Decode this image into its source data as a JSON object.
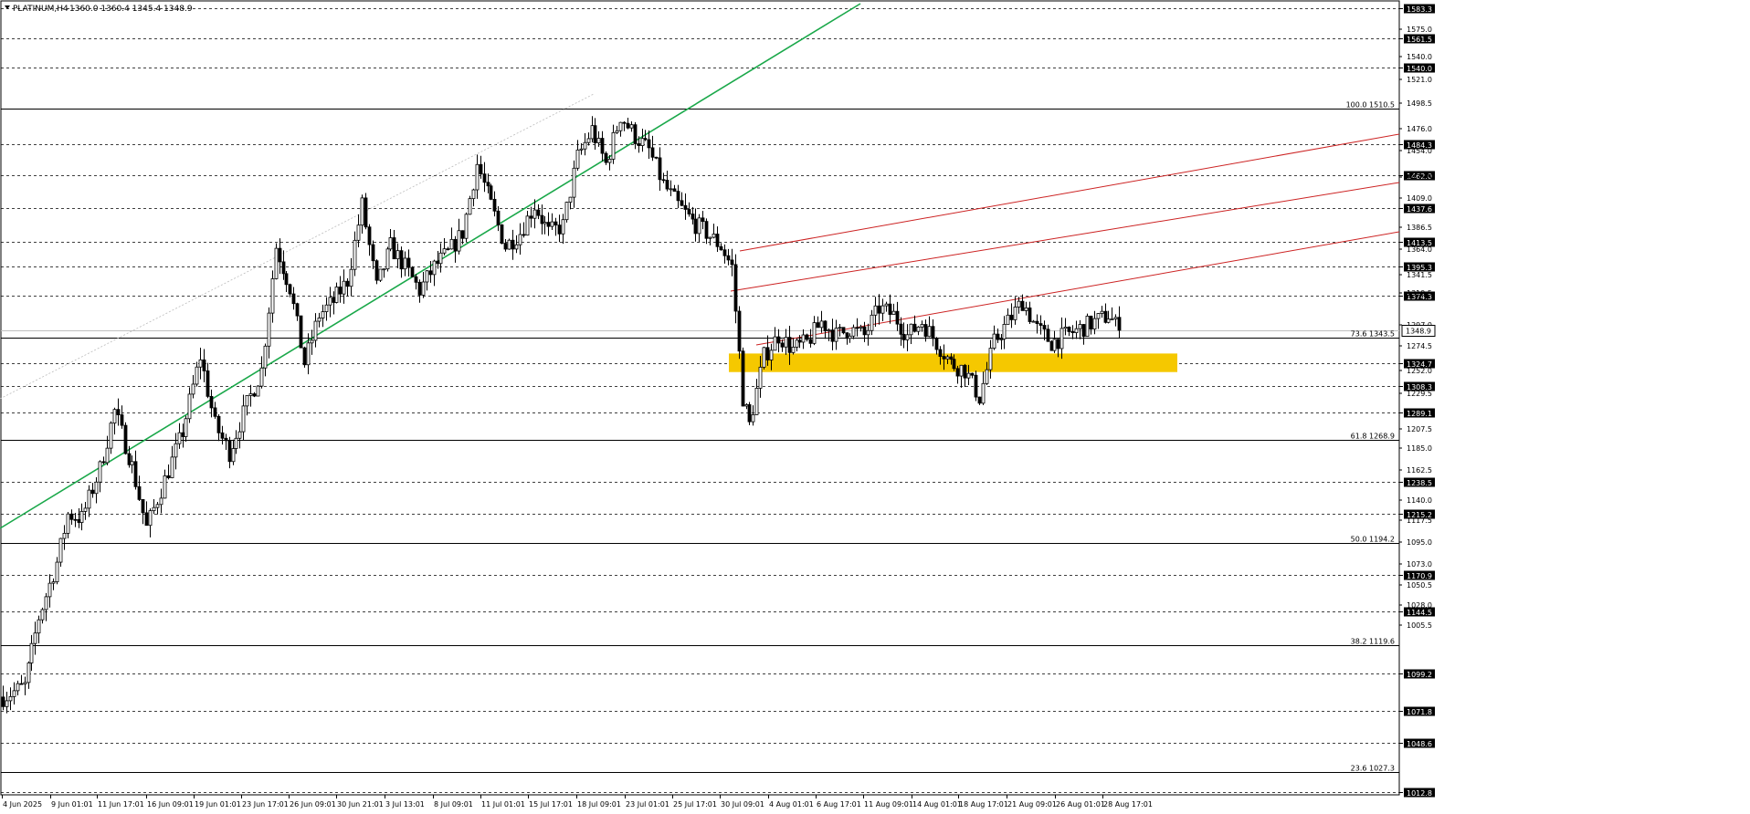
{
  "window": {
    "title": "PLATINUM,H4",
    "ohlc": "1360.0 1360.4 1345.4 1348.9"
  },
  "chart_data": {
    "type": "candlestick",
    "symbol": "PLATINUM",
    "timeframe": "H4",
    "ylim": [
      1000,
      1590
    ],
    "last_price": 1348.9,
    "grid": "horizontal dashed at price levels",
    "price_levels": [
      1583.3,
      1561.5,
      1540.0,
      1484.3,
      1462.0,
      1437.6,
      1413.5,
      1395.3,
      1374.3,
      1324.7,
      1308.3,
      1289.1,
      1238.5,
      1215.2,
      1170.9,
      1144.5,
      1099.2,
      1071.8,
      1048.6,
      1012.8
    ],
    "y_ticks": [
      "1575.0",
      "1540.0",
      "1521.0",
      "1498.5",
      "1476.0",
      "1454.0",
      "1431.5",
      "1409.0",
      "1386.5",
      "1364.0",
      "1341.5",
      "1319.5",
      "1297.0",
      "1274.5",
      "1252.0",
      "1229.5",
      "1207.5",
      "1185.0",
      "1162.5",
      "1140.0",
      "1117.5",
      "1095.0",
      "1073.0",
      "1050.5",
      "1028.0",
      "1005.5"
    ],
    "x_ticks": [
      "4 Jun 2025",
      "9 Jun 01:01",
      "11 Jun 17:01",
      "16 Jun 09:01",
      "19 Jun 01:01",
      "23 Jun 17:01",
      "26 Jun 09:01",
      "30 Jun 21:01",
      "3 Jul 13:01",
      "8 Jul 09:01",
      "11 Jul 01:01",
      "15 Jul 17:01",
      "18 Jul 09:01",
      "23 Jul 01:01",
      "25 Jul 17:01",
      "30 Jul 09:01",
      "4 Aug 01:01",
      "6 Aug 17:01",
      "11 Aug 09:01",
      "14 Aug 01:01",
      "18 Aug 17:01",
      "21 Aug 09:01",
      "26 Aug 01:01",
      "28 Aug 17:01"
    ],
    "fibonacci": [
      {
        "label": "100.0 1510.5",
        "price": 1510.5
      },
      {
        "label": "73.6 1343.5",
        "price": 1343.5
      },
      {
        "label": "61.8 1268.9",
        "price": 1268.9
      },
      {
        "label": "50.0 1194.2",
        "price": 1194.2
      },
      {
        "label": "38.2 1119.6",
        "price": 1119.6
      },
      {
        "label": "23.6 1027.3",
        "price": 1027.3
      }
    ],
    "trendlines": {
      "green": {
        "color": "#1aa84a"
      },
      "red_channel": {
        "color": "#cc2222"
      },
      "dotted": {
        "color": "#bbbbbb"
      }
    },
    "zone": {
      "color": "#f5c800",
      "low": 1318.5,
      "high": 1332.0
    },
    "path_anchors": [
      [
        0,
        1082
      ],
      [
        6,
        1090
      ],
      [
        10,
        1140
      ],
      [
        15,
        1180
      ],
      [
        18,
        1215
      ],
      [
        22,
        1212
      ],
      [
        27,
        1248
      ],
      [
        31,
        1290
      ],
      [
        36,
        1250
      ],
      [
        40,
        1205
      ],
      [
        45,
        1240
      ],
      [
        50,
        1275
      ],
      [
        55,
        1330
      ],
      [
        59,
        1280
      ],
      [
        63,
        1260
      ],
      [
        68,
        1295
      ],
      [
        72,
        1320
      ],
      [
        76,
        1410
      ],
      [
        80,
        1380
      ],
      [
        84,
        1325
      ],
      [
        88,
        1360
      ],
      [
        92,
        1370
      ],
      [
        96,
        1385
      ],
      [
        100,
        1440
      ],
      [
        104,
        1380
      ],
      [
        108,
        1410
      ],
      [
        112,
        1395
      ],
      [
        116,
        1378
      ],
      [
        120,
        1395
      ],
      [
        124,
        1405
      ],
      [
        128,
        1420
      ],
      [
        132,
        1470
      ],
      [
        136,
        1440
      ],
      [
        140,
        1410
      ],
      [
        144,
        1420
      ],
      [
        148,
        1440
      ],
      [
        152,
        1420
      ],
      [
        156,
        1425
      ],
      [
        160,
        1475
      ],
      [
        164,
        1495
      ],
      [
        168,
        1470
      ],
      [
        172,
        1505
      ],
      [
        176,
        1490
      ],
      [
        180,
        1480
      ],
      [
        184,
        1455
      ],
      [
        188,
        1440
      ],
      [
        192,
        1428
      ],
      [
        196,
        1420
      ],
      [
        200,
        1410
      ],
      [
        203,
        1395
      ],
      [
        206,
        1300
      ],
      [
        208,
        1280
      ],
      [
        212,
        1330
      ],
      [
        216,
        1345
      ],
      [
        220,
        1335
      ],
      [
        224,
        1340
      ],
      [
        228,
        1355
      ],
      [
        232,
        1345
      ],
      [
        236,
        1350
      ],
      [
        240,
        1345
      ],
      [
        244,
        1365
      ],
      [
        248,
        1360
      ],
      [
        252,
        1345
      ],
      [
        256,
        1355
      ],
      [
        260,
        1340
      ],
      [
        264,
        1325
      ],
      [
        268,
        1320
      ],
      [
        272,
        1300
      ],
      [
        276,
        1340
      ],
      [
        280,
        1355
      ],
      [
        284,
        1370
      ],
      [
        288,
        1350
      ],
      [
        292,
        1340
      ],
      [
        296,
        1345
      ],
      [
        300,
        1350
      ],
      [
        304,
        1355
      ],
      [
        308,
        1360
      ],
      [
        311,
        1348.9
      ]
    ]
  }
}
